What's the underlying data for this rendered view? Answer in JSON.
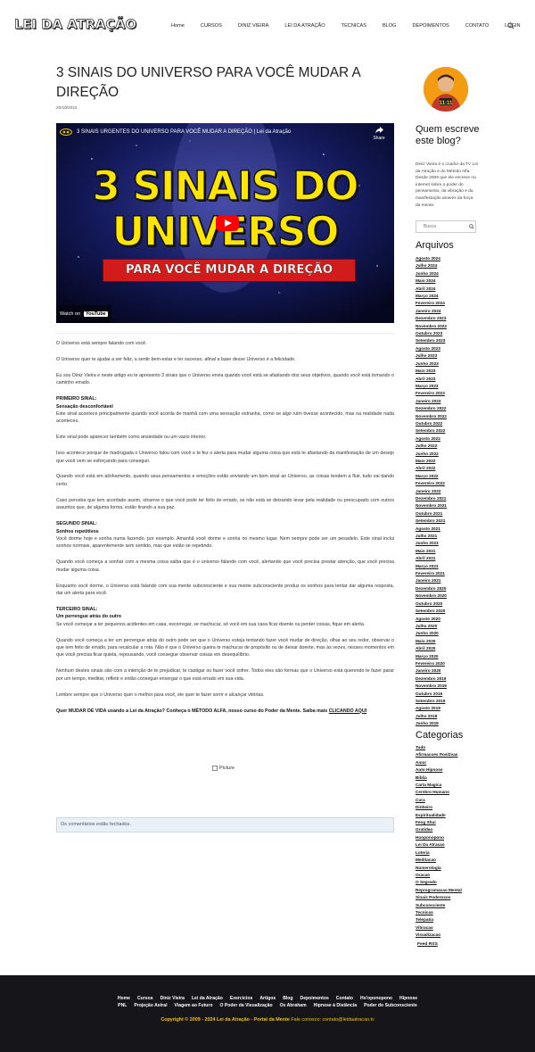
{
  "header": {
    "logo": "LEI DA ATRAÇÃO",
    "nav": [
      "Home",
      "CURSOS",
      "DINIZ VIEIRA",
      "LEI DA ATRAÇÃO",
      "TECNICAS",
      "BLOG",
      "DEPOIMENTOS",
      "CONTATO",
      "LOGIN"
    ]
  },
  "post": {
    "title": "3 SINAIS DO UNIVERSO PARA VOCÊ MUDAR A DIREÇÃO",
    "date": "20/10/2022",
    "video": {
      "title": "3 SINAIS URGENTES DO UNIVERSO PARA VOCÊ MUDAR A DIREÇÃO | Lei da Atração",
      "share": "Share",
      "line1": "3 SINAIS DO",
      "line2": "UNIVERSO",
      "banner": "PARA VOCÊ MUDAR A DIREÇÃO",
      "watch_on": "Watch on",
      "youtube": "YouTube"
    },
    "p1": "O Universo está sempre falando com você.",
    "p2": "O Universo quer te ajudar a ser feliz, a sentir bem-estar e ter sucesso, afinal a base desse Universo é a felicidade.",
    "p3": "Eu sou Diniz Vieira e neste artigo eu te apresento 3 sinais que o Universo envia quando você está se afastando dos seus objetivos, quando você está tomando o caminho errado.",
    "s1_label": "PRIMEIRO SINAL:",
    "s1_title": "Sensação desconfortável",
    "s1_p1": "Este sinal acontece principalmente quando você acorda de manhã com uma sensação estranha, como se algo ruim tivesse acontecido, mas na realidade nada aconteceu.",
    "s1_p2": "Este sinal pode aparecer também como ansiedade ou um vazio interior.",
    "s1_p3": "Isso acontece porque de madrugada o Universo falou com você e te fez o alerta para mudar alguma coisa que está te afastando da manifestação de um desejo que você vem se esforçando para conseguir.",
    "s1_p4": "Quando você está em alinhamento, quando seus pensamentos e emoções estão enviando um bom sinal ao Universo, as coisas tendem a fluir, tudo vai dando certo.",
    "s1_p5": "Caso perceba que tem acordado assim, observe o que você pode ter feito de errado, se não está se deixando levar pela realidade ou preocupado com outros assuntos que, de alguma forma, estão tirando a sua paz.",
    "s2_label": "SEGUNDO SINAL:",
    "s2_title": "Sonhos repetitivos",
    "s2_p1": "Você dorme hoje e sonha numa fazendo, por exemplo. Amanhã você dorme e sonha no mesmo lugar. Nem sempre pode ser um pesadelo. Este sinal inclui sonhos normais, aparentemente sem sentido, mas que estão se repetindo.",
    "s2_p2": "Quando você começa a sonhar com a mesma coisa saiba que é o universo falando com você, alertando que você precisa prestar atenção, que você precisa mudar alguma coisa.",
    "s2_p3": "Enquanto você dorme, o Universo está falando com sua mente subconsciente e sua mente subconsciente produz os sonhos para tentar dar alguma resposta, dar um alerta para você.",
    "s3_label": "TERCEIRO SINAL:",
    "s3_title": "Um perrengue atrás do outro",
    "s3_p1": "Se você começar a ter pequenos acidentes em casa, escorregar, se machucar, só você em sua casa ficar doente ou perder coisas, fique em alerta.",
    "s3_p2": "Quando você começa a ter um perrengue atrás do outro pode ser que o Universo esteja tentando fazer você mudar de direção, olhar ao seu redor, observar o que tem feito de errado, para recalcular a rota. Não é que o Universo queira te machucar de propósito ou de deixar doente, mas às vezes, nesses momentos em que você precisa ficar quieta, repousando, você consegue observar coisas em desequilíbrio.",
    "s3_p3": "Nenhum destes sinais são com a intenção de te prejudicar, te castigar ou fazer você sofrer. Todos eles são formas que o Universo está querendo te fazer parar por um tempo, meditar, refletir e então conseguir enxergar o que está errado em sua vida.",
    "s3_p4": "Lembre sempre que o Universo quer o melhor para você, ele quer te fazer sorrir e alcançar vitórias.",
    "cta_text": "Quer MUDAR DE VIDA usando a Lei da Atração? Conheça o MÉTODO ALFA, nosso curso do Poder da Mente. Saiba mais ",
    "cta_link": "CLICANDO AQUI",
    "picture_alt": "Picture",
    "comments_closed": "Os comentários estão fechados."
  },
  "sidebar": {
    "author_title": "Quem escreve este blog?",
    "bio": "Diniz Vieira é o criador da TV Lei da Atração e do Método Alfa. Desde 2009 que ele escreve na internet sobre o poder do pensamento, da vibração e da manifestação através da força da mente.",
    "search_placeholder": "Busca",
    "archives_title": "Arquivos",
    "archives": [
      "Agosto 2024",
      "Julho 2024",
      "Junho 2024",
      "Maio 2024",
      "Abril 2024",
      "Março 2024",
      "Fevereiro 2024",
      "Janeiro 2024",
      "Dezembro 2023",
      "Novembro 2023",
      "Outubro 2023",
      "Setembro 2023",
      "Agosto 2023",
      "Julho 2023",
      "Junho 2023",
      "Maio 2023",
      "Abril 2023",
      "Março 2023",
      "Fevereiro 2023",
      "Janeiro 2023",
      "Dezembro 2022",
      "Novembro 2022",
      "Outubro 2022",
      "Setembro 2022",
      "Agosto 2022",
      "Julho 2022",
      "Junho 2022",
      "Maio 2022",
      "Abril 2022",
      "Março 2022",
      "Fevereiro 2022",
      "Janeiro 2022",
      "Dezembro 2021",
      "Novembro 2021",
      "Outubro 2021",
      "Setembro 2021",
      "Agosto 2021",
      "Julho 2021",
      "Junho 2021",
      "Maio 2021",
      "Abril 2021",
      "Março 2021",
      "Fevereiro 2021",
      "Janeiro 2021",
      "Dezembro 2020",
      "Novembro 2020",
      "Outubro 2020",
      "Setembro 2020",
      "Agosto 2020",
      "Julho 2020",
      "Junho 2020",
      "Maio 2020",
      "Abril 2020",
      "Março 2020",
      "Fevereiro 2020",
      "Janeiro 2020",
      "Dezembro 2019",
      "Novembro 2019",
      "Outubro 2019",
      "Setembro 2019",
      "Agosto 2019",
      "Julho 2019",
      "Junho 2019"
    ],
    "categories_title": "Categorias",
    "categories": [
      "Tudo",
      "Afirmacoes Positivas",
      "Amor",
      "Auto Hipnose",
      "Bíblia",
      "Carta Magica",
      "Cerebro Humano",
      "Cura",
      "Dinheiro",
      "Espiritualidade",
      "Feng Shui",
      "Gratidao",
      "Hooponopono",
      "Lei Da Atracao",
      "Loteria",
      "Meditacao",
      "Numerologia",
      "Oracao",
      "O Segredo",
      "Reprogramacao Mental",
      "Sinais Poderosos",
      "Subconsciente",
      "Tecnicas",
      "Telepatia",
      "Vibracao",
      "Visualizacao"
    ],
    "feed": "Feed RSS"
  },
  "footer": {
    "row1": [
      "Home",
      "Cursos",
      "Diniz Vieira",
      "Lei da Atração",
      "Exercícios",
      "Artigos",
      "Blog",
      "Depoimentos",
      "Contato",
      "Ho'oponopono",
      "Hipnose"
    ],
    "row2": [
      "PNL",
      "Projeção Astral",
      "Viagem ao Futuro",
      "O Poder da Visualização",
      "Os Abraham",
      "Hipnose à Distância",
      "Poder do Subconsciente"
    ],
    "copyright": "Copyright © 2009 - 2024 Lei da Atração - Portal da Mente",
    "contact": " Fale conosco: contato@leidaatracao.tv"
  },
  "colors": {
    "accent": "#f1c40f",
    "footer_bg": "#15151a",
    "video_text": "#ffe600",
    "banner": "#d21b1b"
  }
}
